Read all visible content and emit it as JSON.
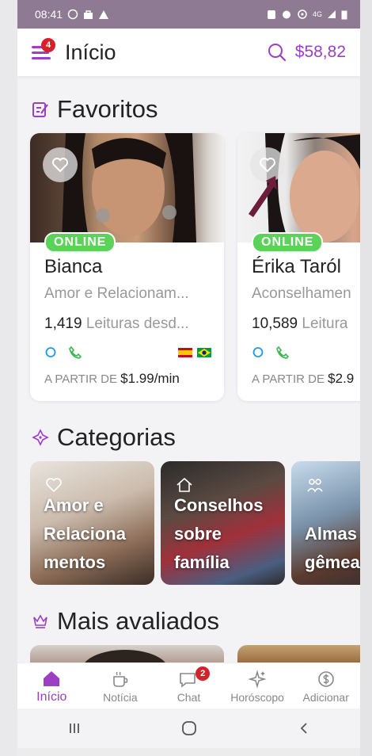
{
  "status_bar": {
    "time": "08:41",
    "network": "4G"
  },
  "header": {
    "menu_badge": "4",
    "title": "Início",
    "balance": "$58,82"
  },
  "favorites": {
    "title": "Favoritos",
    "cards": [
      {
        "status": "ONLINE",
        "name": "Bianca",
        "specialty": "Amor e Relacionam...",
        "reads_count": "1,419",
        "reads_text": "Leituras desd...",
        "price_prefix": "A PARTIR DE",
        "price": "$1.99/min"
      },
      {
        "status": "ONLINE",
        "name": "Érika Taról",
        "specialty": "Aconselhamen",
        "reads_count": "10,589",
        "reads_text": "Leitura",
        "price_prefix": "A PARTIR DE",
        "price": "$2.9"
      }
    ]
  },
  "categories": {
    "title": "Categorias",
    "items": [
      {
        "label_lines": [
          "Amor e",
          "Relaciona",
          "mentos"
        ]
      },
      {
        "label_lines": [
          "Conselhos",
          "sobre",
          "família"
        ]
      },
      {
        "label_lines": [
          "Almas",
          "gêmea"
        ]
      }
    ]
  },
  "top_rated": {
    "title": "Mais avaliados"
  },
  "bottom_nav": {
    "items": [
      {
        "label": "Início",
        "active": true
      },
      {
        "label": "Notícia"
      },
      {
        "label": "Chat",
        "badge": "2"
      },
      {
        "label": "Horóscopo"
      },
      {
        "label": "Adicionar"
      }
    ]
  },
  "colors": {
    "accent": "#9c3fc4",
    "online": "#5bd35b",
    "badge": "#d6202a"
  }
}
